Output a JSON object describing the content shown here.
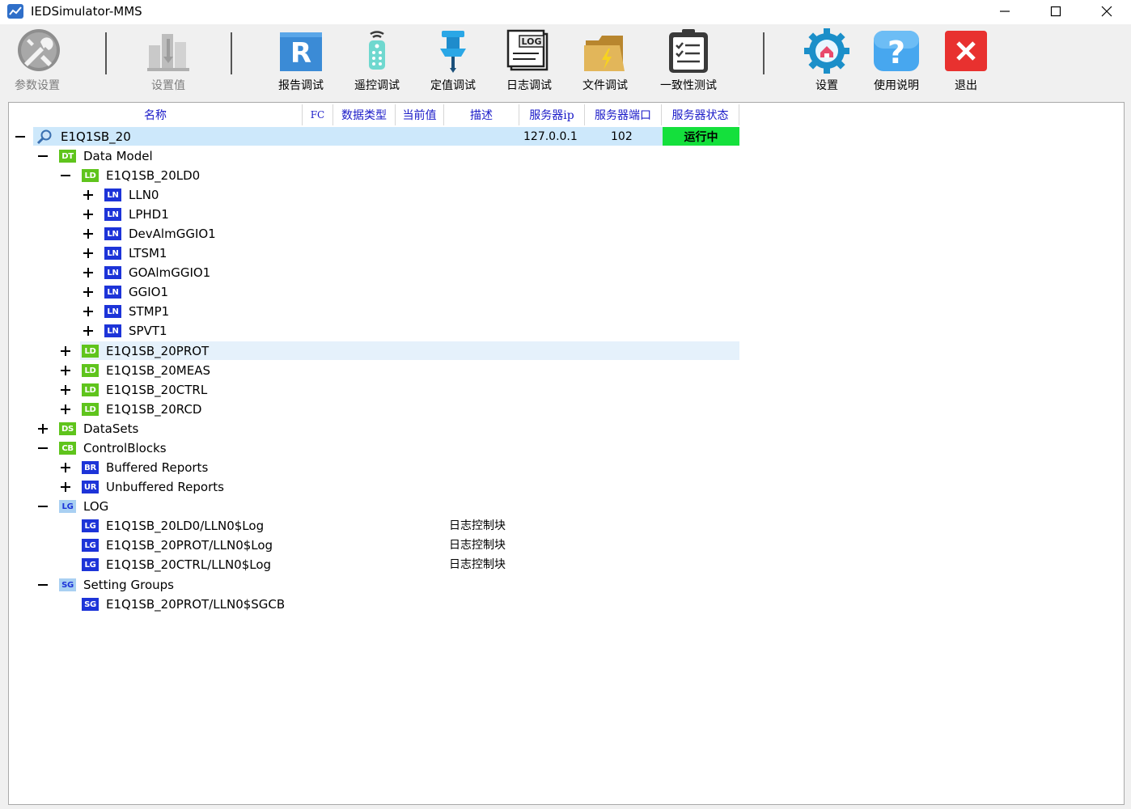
{
  "window": {
    "title": "IEDSimulator-MMS"
  },
  "toolbar": {
    "items": [
      {
        "label": "参数设置",
        "icon": "tools-icon"
      },
      {
        "label": "设置值",
        "icon": "chart-icon"
      },
      {
        "label": "报告调试",
        "icon": "report-icon"
      },
      {
        "label": "遥控调试",
        "icon": "remote-icon"
      },
      {
        "label": "定值调试",
        "icon": "pin-icon"
      },
      {
        "label": "日志调试",
        "icon": "log-icon"
      },
      {
        "label": "文件调试",
        "icon": "folder-icon"
      },
      {
        "label": "一致性测试",
        "icon": "clipboard-icon"
      },
      {
        "label": "设置",
        "icon": "settings-icon"
      },
      {
        "label": "使用说明",
        "icon": "help-icon"
      },
      {
        "label": "退出",
        "icon": "exit-icon"
      }
    ]
  },
  "columns": [
    "名称",
    "FC",
    "数据类型",
    "当前值",
    "描述",
    "服务器ip",
    "服务器端口",
    "服务器状态"
  ],
  "tree": {
    "root": {
      "label": "E1Q1SB_20",
      "ip": "127.0.0.1",
      "port": "102",
      "status": "运行中"
    },
    "data_model": {
      "badge": "DT",
      "label": "Data Model"
    },
    "ld0": {
      "badge": "LD",
      "label": "E1Q1SB_20LD0"
    },
    "logical_nodes": [
      {
        "badge": "LN",
        "label": "LLN0"
      },
      {
        "badge": "LN",
        "label": "LPHD1"
      },
      {
        "badge": "LN",
        "label": "DevAlmGGIO1"
      },
      {
        "badge": "LN",
        "label": "LTSM1"
      },
      {
        "badge": "LN",
        "label": "GOAlmGGIO1"
      },
      {
        "badge": "LN",
        "label": "GGIO1"
      },
      {
        "badge": "LN",
        "label": "STMP1"
      },
      {
        "badge": "LN",
        "label": "SPVT1"
      }
    ],
    "other_lds": [
      {
        "badge": "LD",
        "label": "E1Q1SB_20PROT"
      },
      {
        "badge": "LD",
        "label": "E1Q1SB_20MEAS"
      },
      {
        "badge": "LD",
        "label": "E1Q1SB_20CTRL"
      },
      {
        "badge": "LD",
        "label": "E1Q1SB_20RCD"
      }
    ],
    "datasets": {
      "badge": "DS",
      "label": "DataSets"
    },
    "control_blocks": {
      "badge": "CB",
      "label": "ControlBlocks"
    },
    "control_children": [
      {
        "badge": "BR",
        "label": "Buffered Reports"
      },
      {
        "badge": "UR",
        "label": "Unbuffered Reports"
      }
    ],
    "log": {
      "badge": "LG",
      "label": "LOG"
    },
    "log_children": [
      {
        "badge": "LG",
        "label": "E1Q1SB_20LD0/LLN0$Log",
        "desc": "日志控制块"
      },
      {
        "badge": "LG",
        "label": "E1Q1SB_20PROT/LLN0$Log",
        "desc": "日志控制块"
      },
      {
        "badge": "LG",
        "label": "E1Q1SB_20CTRL/LLN0$Log",
        "desc": "日志控制块"
      }
    ],
    "setting_groups": {
      "badge": "SG",
      "label": "Setting Groups"
    },
    "sg_children": [
      {
        "badge": "SG",
        "label": "E1Q1SB_20PROT/LLN0$SGCB"
      }
    ]
  }
}
